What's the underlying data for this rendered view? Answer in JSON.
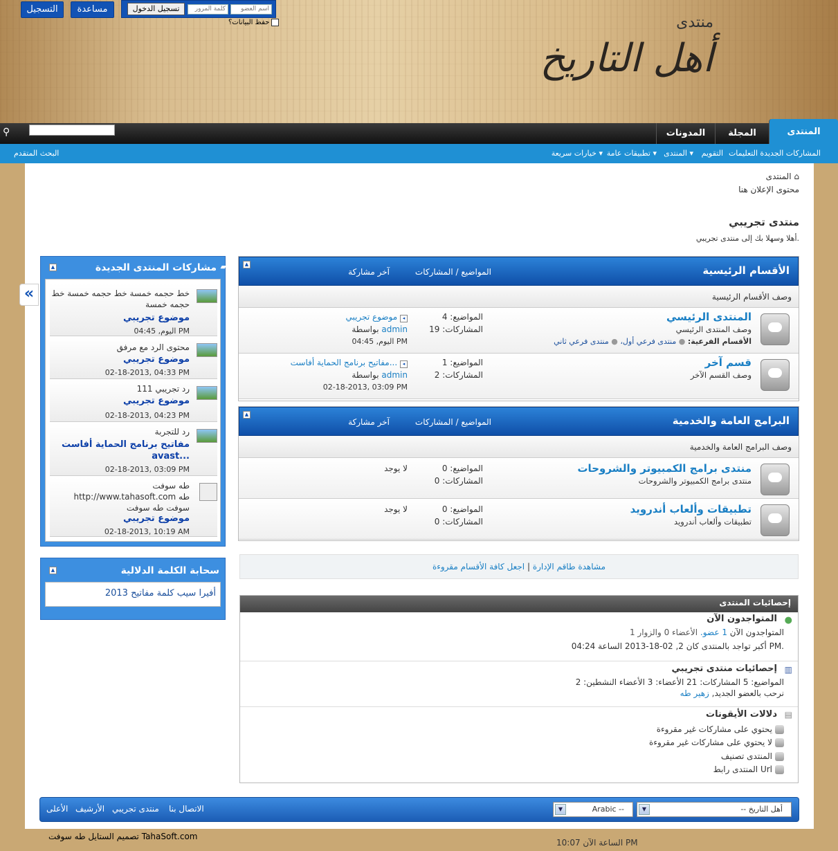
{
  "header": {
    "logo_small": "منتدى",
    "logo_big": "أهل التاريخ",
    "register_label": "التسجيل",
    "help_label": "مساعدة",
    "username_placeholder": "اسم العضو",
    "password_placeholder": "كلمة المرور",
    "login_label": "تسجيل الدخول",
    "remember_label": "حفظ البيانات؟"
  },
  "nav": {
    "tabs": [
      "المنتدى",
      "المجلة",
      "المدونات"
    ],
    "search_icon": "search-icon"
  },
  "subnav": {
    "items": [
      "المشاركات الجديدة",
      "التعليمات",
      "التقويم",
      "المنتدى ▾",
      "تطبيقات عامة ▾",
      "خيارات سريعة ▾"
    ],
    "advanced_search": "البحث المتقدم"
  },
  "breadcrumb": {
    "home": "المنتدى"
  },
  "ad_text": "محتوى الإعلان هنا",
  "page": {
    "title": "منتدى تجريبي",
    "welcome": "أهلا وسهلا بك إلى منتدى تجريبي."
  },
  "columns": {
    "threads_posts": "المواضيع / المشاركات",
    "last_post": "آخر مشاركة"
  },
  "categories": [
    {
      "title": "الأقسام الرئيسية",
      "desc": "وصف الأقسام الرئيسية",
      "forums": [
        {
          "title": "المنتدى الرئيسي",
          "desc": "وصف المنتدى الرئيسي",
          "sub_label": "الأقسام الفرعية:",
          "subs": [
            "منتدى فرعي أول،",
            "منتدى فرعي ثاني"
          ],
          "threads": "المواضيع: 4",
          "posts": "المشاركات: 19",
          "last_title": "موضوع تجريبي",
          "by_label": "بواسطة",
          "by_user": "admin",
          "last_date": "اليوم, 04:45 PM"
        },
        {
          "title": "قسم آخر",
          "desc": "وصف القسم الآخر",
          "threads": "المواضيع: 1",
          "posts": "المشاركات: 2",
          "last_title": "مفاتيح برنامج الحماية أفاست...",
          "by_label": "بواسطة",
          "by_user": "admin",
          "last_date": "02-18-2013, 03:09 PM"
        }
      ]
    },
    {
      "title": "البرامج العامة والخدمية",
      "desc": "وصف البرامج العامة والخدمية",
      "forums": [
        {
          "title": "منتدى برامج الكمبيوتر والشروحات",
          "desc": "منتدى برامج الكمبيوتر والشروحات",
          "threads": "المواضيع: 0",
          "posts": "المشاركات: 0",
          "last_none": "لا يوجد"
        },
        {
          "title": "تطبيقات وألعاب أندرويد",
          "desc": "تطبيقات وألعاب أندرويد",
          "threads": "المواضيع: 0",
          "posts": "المشاركات: 0",
          "last_none": "لا يوجد"
        }
      ]
    }
  ],
  "actions": {
    "mark_read": "اجعل كافة الأقسام مقروءة",
    "sep": "|",
    "view_staff": "مشاهدة طاقم الإدارة"
  },
  "sidebar": {
    "new_posts_title": "مشاركات المنتدى الجديدة",
    "items": [
      {
        "text": "خط حجمه خمسة خط حجمه خمسة خط حجمه خمسة",
        "title": "موضوع تجريبي",
        "date": "اليوم, 04:45 PM"
      },
      {
        "text": "محتوى الرد مع مرفق",
        "title": "موضوع تجريبي",
        "date": "02-18-2013, 04:33 PM"
      },
      {
        "text": "رد تجريبي 111",
        "title": "موضوع تجريبي",
        "date": "02-18-2013, 04:23 PM"
      },
      {
        "text": "رد للتجربة",
        "title": "مفاتيح برنامج الحماية أفاست avast...",
        "date": "02-18-2013, 03:09 PM"
      },
      {
        "text": "طه سوفت http://www.tahasoft.com طه سوفت طه سوفت",
        "title": "موضوع تجريبي",
        "date": "02-18-2013, 10:19 AM"
      }
    ],
    "tag_cloud_title": "سحابة الكلمة الدلالية",
    "tags": "2013 أفيرا سيب كلمة مفاتيح"
  },
  "stats": {
    "header": "إحصائيات المنتدى",
    "online_title": "المتواجدون الآن",
    "online_prefix": "المتواجدون الآن",
    "online_members": "1 عضو.",
    "online_rest": "الأعضاء 0 والزوار 1",
    "record": "أكبر تواجد بالمنتدى كان 2, 02-18-2013 الساعة 04:24 PM.",
    "forum_stats_title": "إحصائيات منتدى تجريبي",
    "forum_stats_line": "المواضيع: 5   المشاركات: 21   الأعضاء: 3   الأعضاء النشطين: 2",
    "welcome_new": "نرحب بالعضو الجديد,",
    "new_member": "زهير طه",
    "legend_title": "دلالات الأيقونات",
    "legend": [
      "يحتوي على مشاركات غير مقروءة",
      "لا يحتوي على مشاركات غير مقروءة",
      "المنتدى تصنيف",
      "المنتدى رابط Url"
    ]
  },
  "footer": {
    "style_select": "-- أهل التاريخ",
    "lang_select": "Arabic --",
    "links": [
      "الاتصال بنا",
      "منتدى تجريبي",
      "الأرشيف",
      "الأعلى"
    ],
    "credit": "تصميم الستايل طه سوفت TahaSoft.com",
    "time": "الساعة الآن 10:07 PM"
  }
}
